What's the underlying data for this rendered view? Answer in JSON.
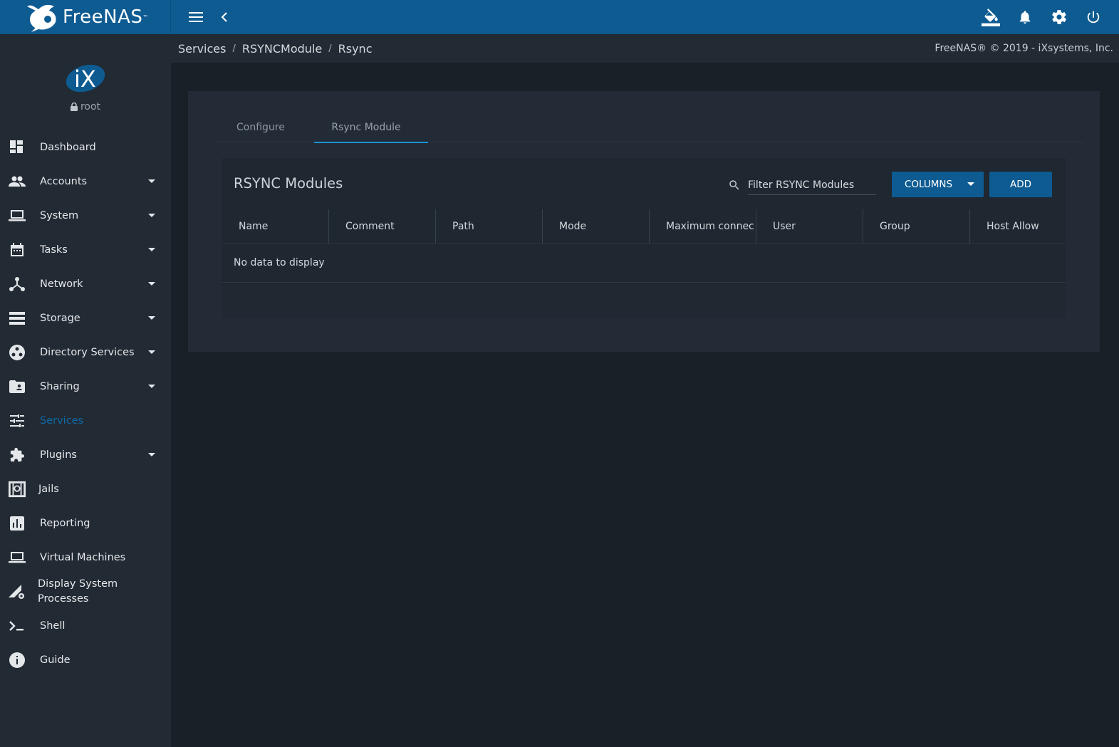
{
  "topbar": {
    "brand": "FreeNAS",
    "brand_tm": "™"
  },
  "sidebar": {
    "user": "root",
    "items": [
      {
        "label": "Dashboard",
        "icon": "dashboard-icon",
        "expandable": false
      },
      {
        "label": "Accounts",
        "icon": "people-icon",
        "expandable": true
      },
      {
        "label": "System",
        "icon": "laptop-icon",
        "expandable": true
      },
      {
        "label": "Tasks",
        "icon": "calendar-icon",
        "expandable": true
      },
      {
        "label": "Network",
        "icon": "network-icon",
        "expandable": true
      },
      {
        "label": "Storage",
        "icon": "storage-icon",
        "expandable": true
      },
      {
        "label": "Directory Services",
        "icon": "directory-icon",
        "expandable": true
      },
      {
        "label": "Sharing",
        "icon": "folder-shared-icon",
        "expandable": true
      },
      {
        "label": "Services",
        "icon": "tune-icon",
        "expandable": false,
        "active": true
      },
      {
        "label": "Plugins",
        "icon": "extension-icon",
        "expandable": true
      },
      {
        "label": "Jails",
        "icon": "jail-icon",
        "expandable": false
      },
      {
        "label": "Reporting",
        "icon": "chart-icon",
        "expandable": false
      },
      {
        "label": "Virtual Machines",
        "icon": "computer-icon",
        "expandable": false
      },
      {
        "label": "Display System Processes",
        "icon": "processes-icon",
        "expandable": false
      },
      {
        "label": "Shell",
        "icon": "console-icon",
        "expandable": false
      },
      {
        "label": "Guide",
        "icon": "info-icon",
        "expandable": false
      }
    ]
  },
  "breadcrumb": {
    "items": [
      "Services",
      "RSYNCModule",
      "Rsync"
    ],
    "separator": "/"
  },
  "copyright": "FreeNAS® © 2019 - iXsystems, Inc.",
  "tabs": [
    {
      "label": "Configure",
      "active": false
    },
    {
      "label": "Rsync Module",
      "active": true
    }
  ],
  "panel": {
    "title": "RSYNC Modules",
    "filter_placeholder": "Filter RSYNC Modules",
    "columns_button": "COLUMNS",
    "add_button": "ADD",
    "columns": [
      "Name",
      "Comment",
      "Path",
      "Mode",
      "Maximum connec",
      "User",
      "Group",
      "Host Allow"
    ],
    "empty_message": "No data to display"
  },
  "colors": {
    "topbar": "#0e5b92",
    "sidebar": "#222a33",
    "background": "#1a2028",
    "accent": "#1e90d6",
    "active_nav": "#0e6aa8"
  }
}
